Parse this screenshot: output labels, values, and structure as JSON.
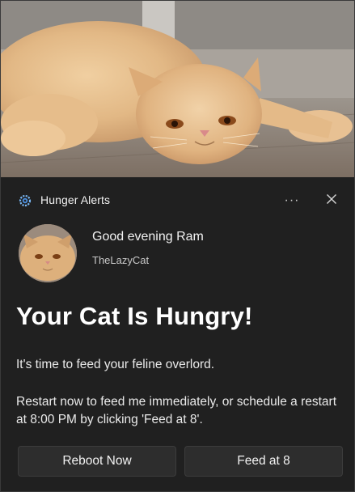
{
  "header": {
    "app_name": "Hunger Alerts",
    "app_icon": "gear-icon",
    "more_label": "···",
    "close_icon": "close-icon"
  },
  "sender": {
    "greeting": "Good evening Ram",
    "name": "TheLazyCat"
  },
  "content": {
    "title": "Your Cat Is Hungry!",
    "line1": "It's time to feed your feline overlord.",
    "line2": "Restart now to feed me immediately, or schedule a restart at 8:00 PM by clicking 'Feed at 8'."
  },
  "actions": {
    "reboot_label": "Reboot Now",
    "feed_label": "Feed at 8"
  },
  "colors": {
    "background": "#202020",
    "button_bg": "#2d2d2d",
    "text": "#ffffff",
    "fur": "#e1b98a"
  }
}
